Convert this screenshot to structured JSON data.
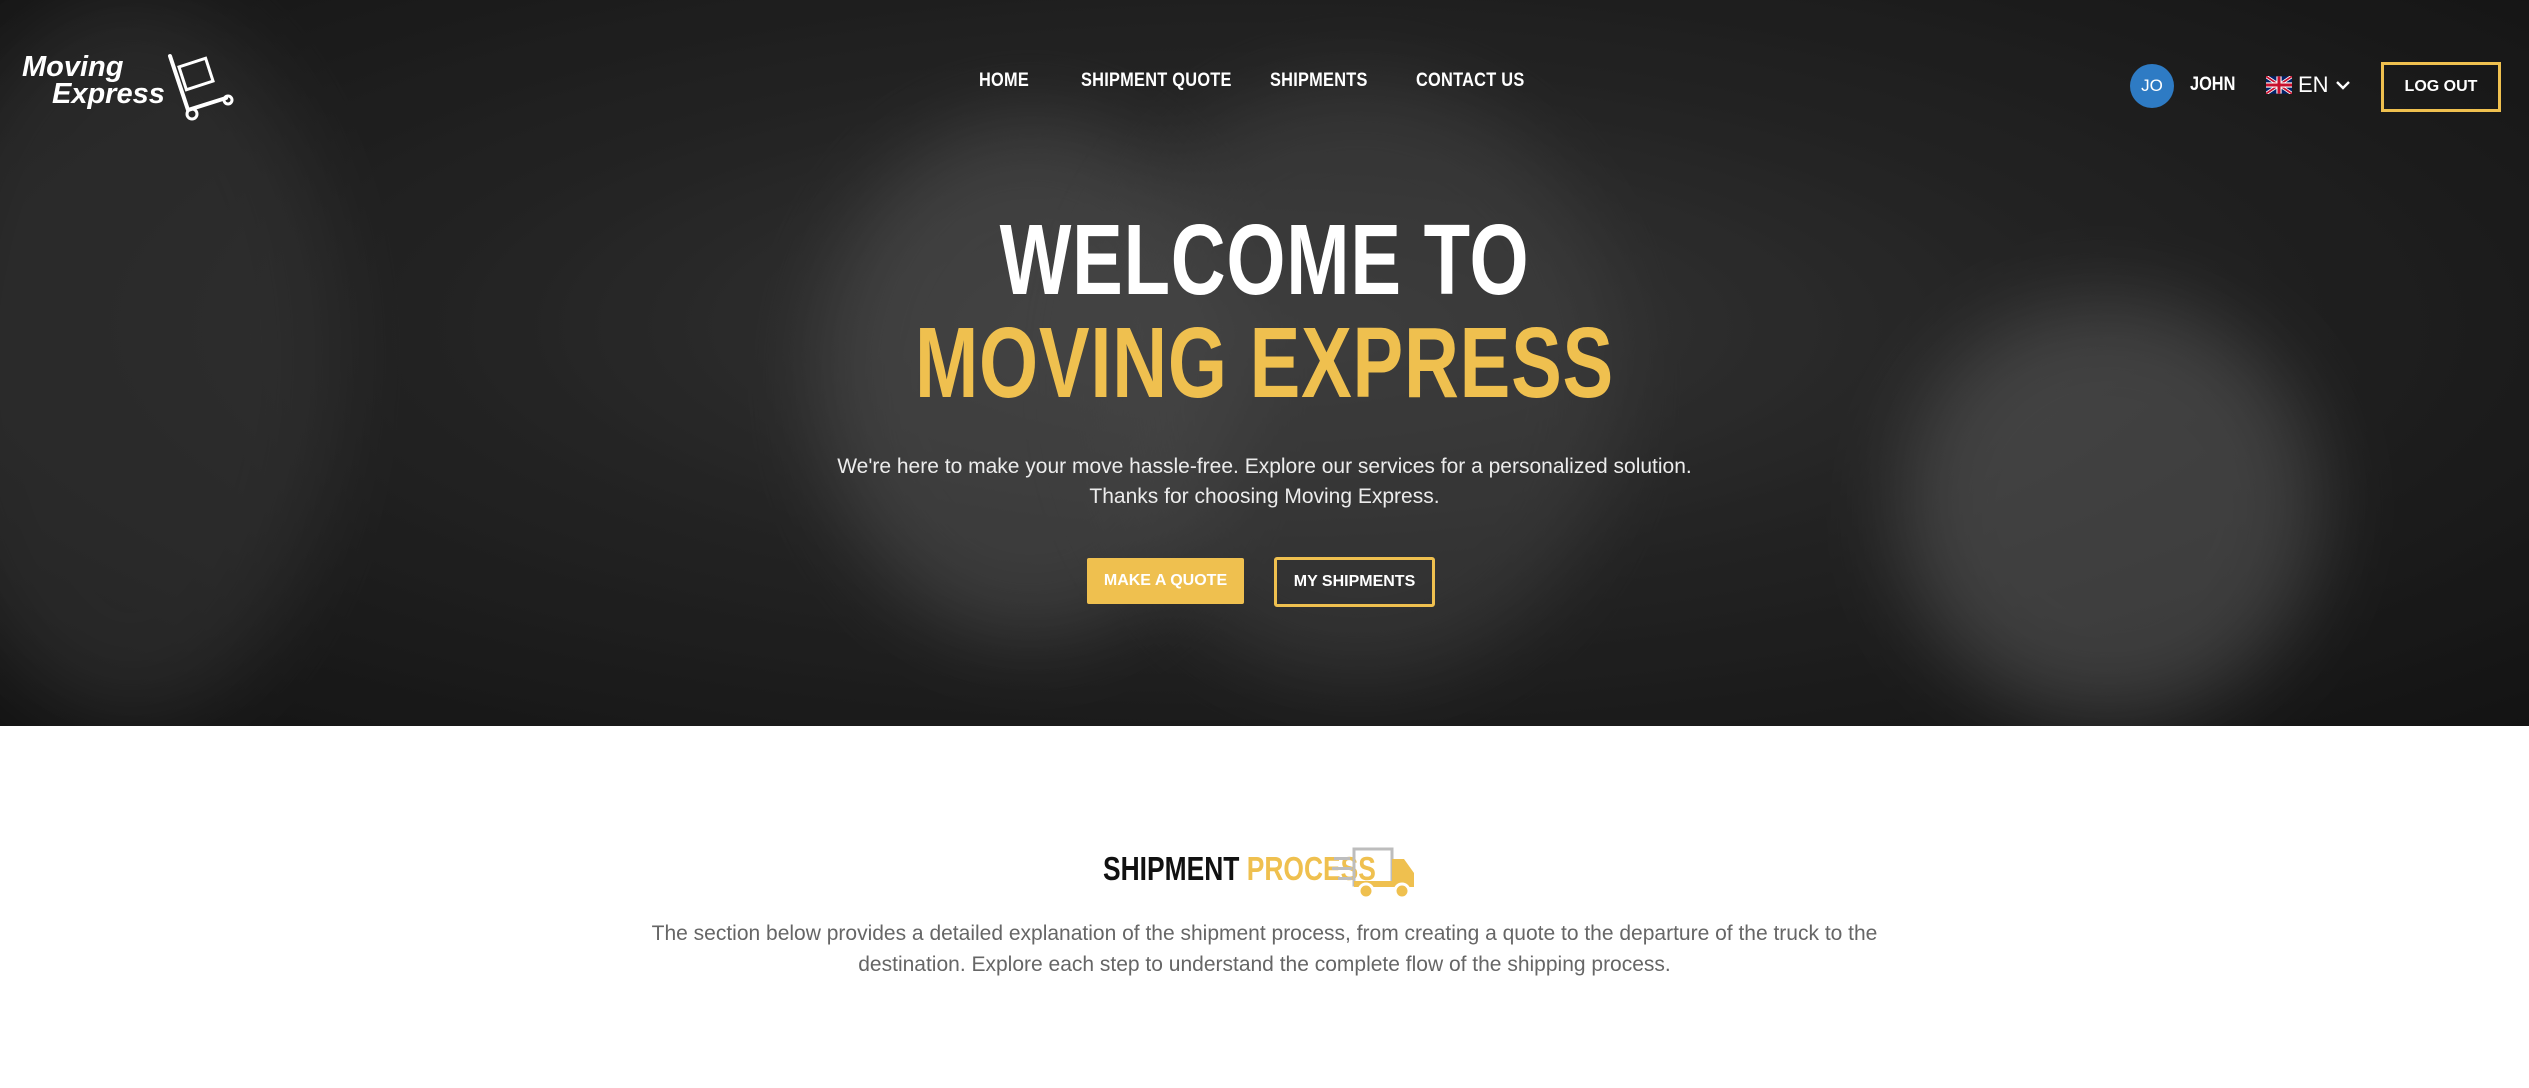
{
  "logo": {
    "line1": "Moving",
    "line2": "Express"
  },
  "nav": {
    "items": [
      "HOME",
      "SHIPMENT QUOTE",
      "SHIPMENTS",
      "CONTACT US"
    ]
  },
  "user": {
    "initials": "JO",
    "name": "JOHN",
    "avatar_color": "#2e7bc4"
  },
  "language": {
    "code": "EN",
    "flag_icon": "uk-flag-icon"
  },
  "header": {
    "logout_label": "LOG OUT"
  },
  "hero": {
    "title_line1": "WELCOME TO",
    "title_line2": "MOVING EXPRESS",
    "subtitle_line1": "We're here to make your move hassle-free. Explore our services for a personalized solution.",
    "subtitle_line2": "Thanks for choosing Moving Express.",
    "primary_button": "MAKE A QUOTE",
    "secondary_button": "MY SHIPMENTS"
  },
  "process": {
    "title_word1": "SHIPMENT",
    "title_word2": "PROCESS",
    "description_line1": "The section below provides a detailed explanation of the shipment process, from creating a quote to the departure of the truck to the",
    "description_line2": "destination. Explore each step to understand the complete flow of the shipping process."
  },
  "colors": {
    "accent": "#efc04f",
    "hero_dark": "#2f2f2f",
    "text_muted": "#666666"
  }
}
